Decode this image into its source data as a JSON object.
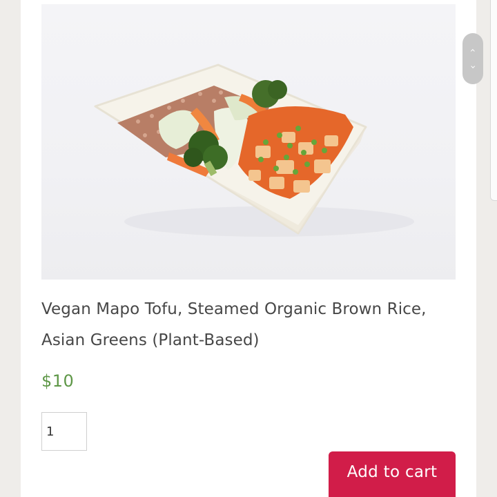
{
  "product": {
    "image_alt": "Vegan Mapo Tofu bowl with brown rice and greens",
    "title": "Vegan Mapo Tofu, Steamed Organic Brown Rice, Asian Greens (Plant-Based)",
    "price": "$10",
    "quantity": "1"
  },
  "actions": {
    "add_to_cart_label": "Add to cart"
  },
  "scroll_nav": {
    "up_icon": "chevron-up-icon",
    "down_icon": "chevron-down-icon"
  },
  "colors": {
    "price": "#5e9747",
    "button": "#d11d49",
    "background": "#efedea"
  }
}
